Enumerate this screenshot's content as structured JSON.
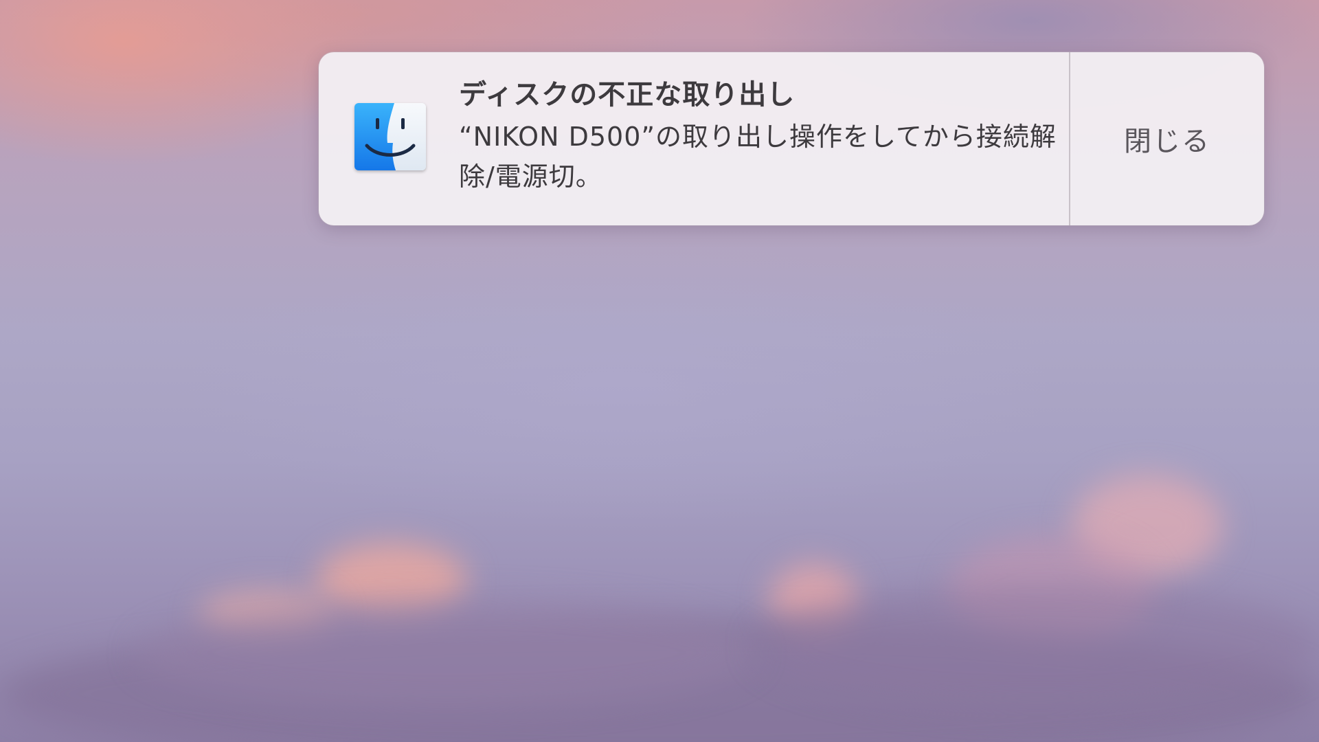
{
  "notification": {
    "app_icon": "finder-icon",
    "title": "ディスクの不正な取り出し",
    "body": "“NIKON D500”の取り出し操作をしてから接続解除/電源切。",
    "close_label": "閉じる"
  },
  "colors": {
    "finder_blue": "#1a8ef0",
    "finder_light": "#e8f1fb",
    "text": "#3d3a3e"
  },
  "background": {
    "type": "cloudy-sky-wallpaper"
  }
}
